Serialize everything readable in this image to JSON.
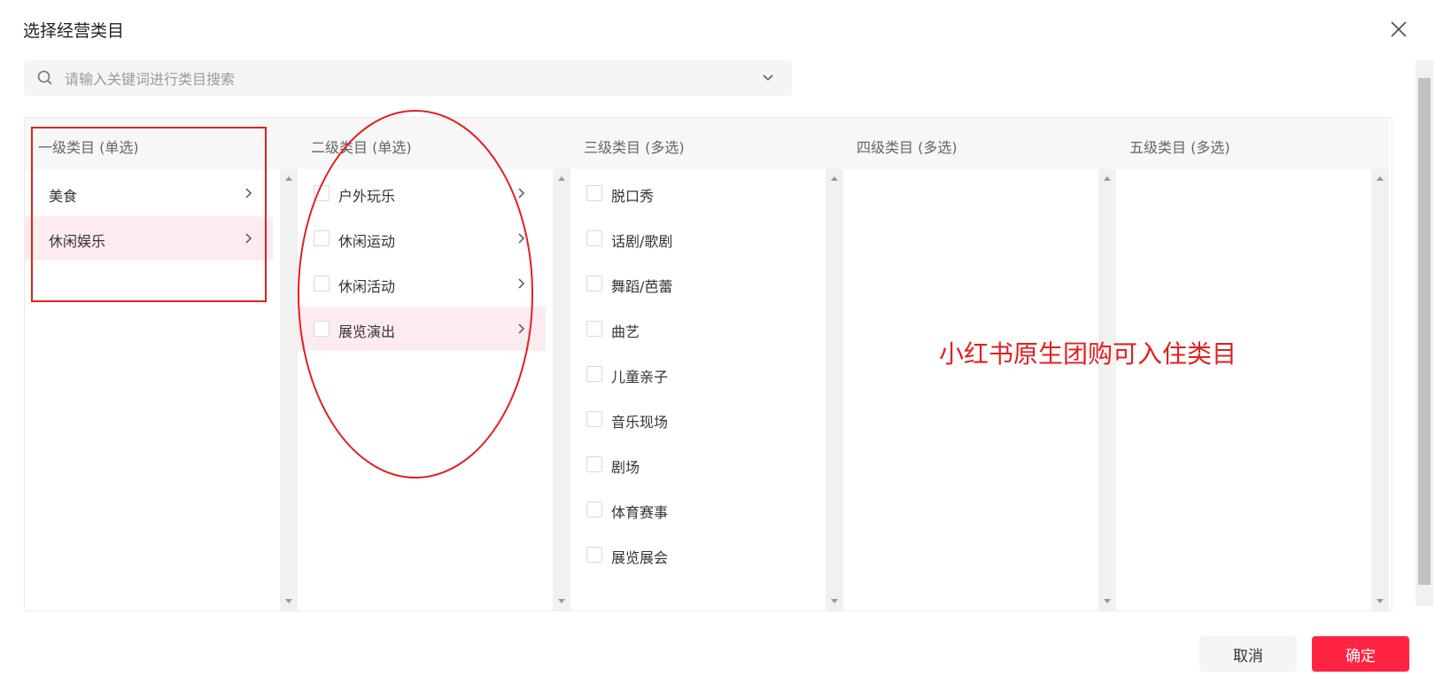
{
  "dialog": {
    "title": "选择经营类目",
    "search_placeholder": "请输入关键词进行类目搜索"
  },
  "columns": [
    {
      "header": "一级类目 (单选)",
      "items": [
        {
          "label": "美食",
          "selected": false
        },
        {
          "label": "休闲娱乐",
          "selected": true
        }
      ]
    },
    {
      "header": "二级类目 (单选)",
      "items": [
        {
          "label": "户外玩乐",
          "selected": false
        },
        {
          "label": "休闲运动",
          "selected": false
        },
        {
          "label": "休闲活动",
          "selected": false
        },
        {
          "label": "展览演出",
          "selected": true
        }
      ]
    },
    {
      "header": "三级类目 (多选)",
      "items": [
        {
          "label": "脱口秀"
        },
        {
          "label": "话剧/歌剧"
        },
        {
          "label": "舞蹈/芭蕾"
        },
        {
          "label": "曲艺"
        },
        {
          "label": "儿童亲子"
        },
        {
          "label": "音乐现场"
        },
        {
          "label": "剧场"
        },
        {
          "label": "体育赛事"
        },
        {
          "label": "展览展会"
        }
      ]
    },
    {
      "header": "四级类目 (多选)",
      "items": []
    },
    {
      "header": "五级类目 (多选)",
      "items": []
    }
  ],
  "annotation": {
    "text": "小红书原生团购可入住类目",
    "color": "#e02020"
  },
  "footer": {
    "cancel_label": "取消",
    "confirm_label": "确定"
  },
  "colors": {
    "accent": "#ff2442",
    "selected_row_bg": "#fdecef"
  },
  "icons": [
    "close-icon",
    "search-icon",
    "chevron-down-icon",
    "chevron-right-icon"
  ]
}
